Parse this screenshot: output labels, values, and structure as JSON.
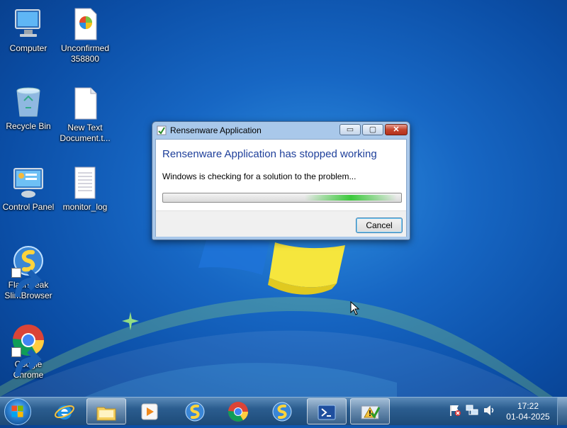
{
  "desktop": {
    "icons": [
      {
        "label": "Computer",
        "icon": "computer-icon"
      },
      {
        "label": "Unconfirmed 358800",
        "icon": "file-icon"
      },
      {
        "label": "Recycle Bin",
        "icon": "recycle-bin-icon"
      },
      {
        "label": "New Text Document.t...",
        "icon": "text-document-icon"
      },
      {
        "label": "Control Panel",
        "icon": "control-panel-icon"
      },
      {
        "label": "monitor_log",
        "icon": "text-document-icon"
      },
      {
        "label": "FlashPeak SlimBrowser",
        "icon": "slimbrowser-icon"
      },
      {
        "label": "Google Chrome",
        "icon": "chrome-icon"
      }
    ]
  },
  "dialog": {
    "title": "Rensenware Application",
    "heading": "Rensenware Application has stopped working",
    "message": "Windows is checking for a solution to the problem...",
    "cancel_label": "Cancel",
    "minimize_glyph": "▭",
    "maximize_glyph": "▢",
    "close_glyph": "✕"
  },
  "taskbar": {
    "apps": [
      "Internet Explorer",
      "Windows Explorer",
      "Windows Media Player",
      "FlashPeak SlimBrowser",
      "Google Chrome",
      "FlashPeak SlimBrowser",
      "Windows PowerShell",
      "Action Center"
    ],
    "clock": {
      "time": "17:22",
      "date": "01-04-2025"
    }
  },
  "colors": {
    "heading": "#1e3f9a",
    "accent": "#1767c4"
  }
}
